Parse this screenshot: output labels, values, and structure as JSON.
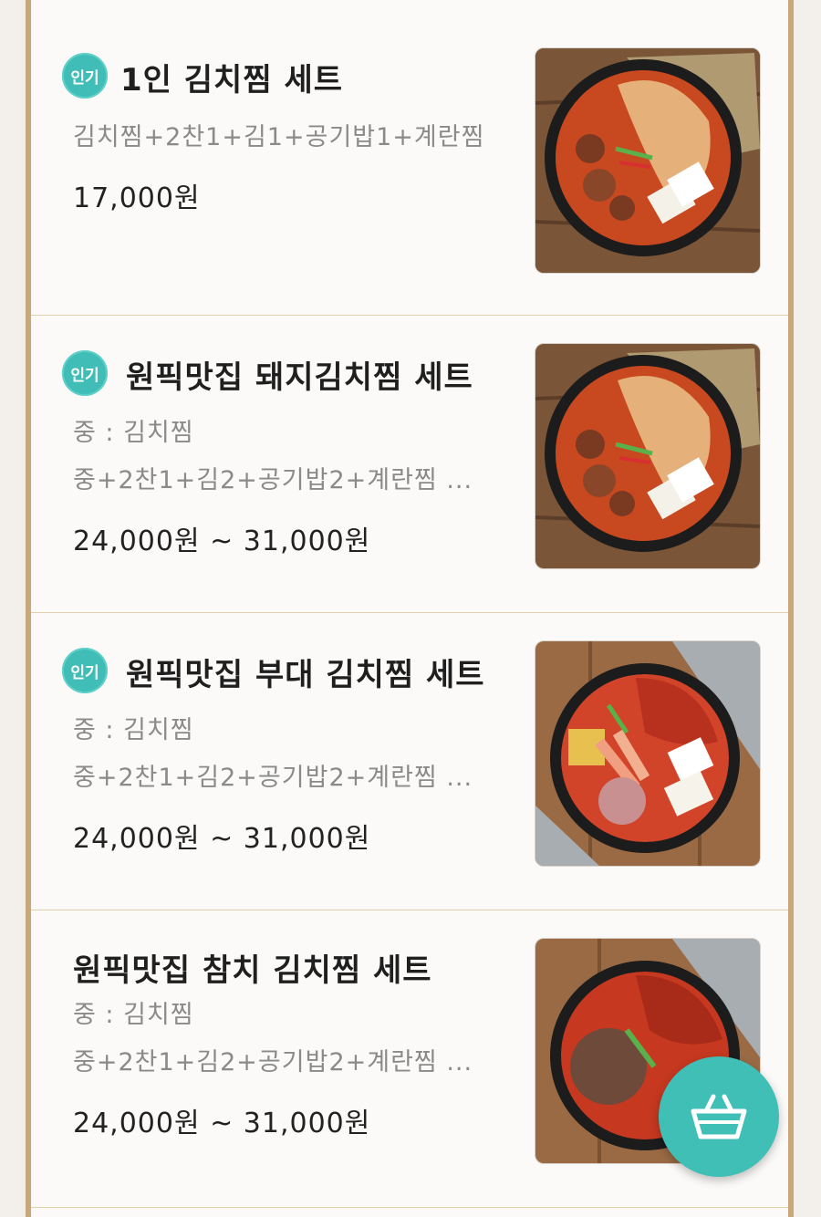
{
  "menu": {
    "items": [
      {
        "badge": "인기",
        "title": "1인 김치찜 세트",
        "desc_lines": [
          "김치찜+2찬1+김1+공기밥1+계란찜"
        ],
        "price": "17,000원",
        "image_icon": "kimchi-jjim-pork-photo"
      },
      {
        "badge": "인기",
        "title": "원픽맛집 돼지김치찜 세트",
        "desc_lines": [
          "중 : 김치찜",
          "중+2찬1+김2+공기밥2+계란찜 ..."
        ],
        "price": "24,000원 ~ 31,000원",
        "image_icon": "kimchi-jjim-pork-photo"
      },
      {
        "badge": "인기",
        "title": "원픽맛집 부대 김치찜 세트",
        "desc_lines": [
          "중 : 김치찜",
          "중+2찬1+김2+공기밥2+계란찜 ..."
        ],
        "price": "24,000원 ~ 31,000원",
        "image_icon": "budae-kimchi-jjim-photo"
      },
      {
        "badge": "",
        "title": "원픽맛집 참치 김치찜 세트",
        "desc_lines": [
          "중 : 김치찜",
          "중+2찬1+김2+공기밥2+계란찜 ..."
        ],
        "price": "24,000원 ~ 31,000원",
        "image_icon": "tuna-kimchi-jjim-photo"
      }
    ]
  },
  "cart_button": {
    "icon": "basket-icon"
  },
  "colors": {
    "accent": "#40bfb7",
    "frame": "#c8a878",
    "divider": "#e2cfae"
  }
}
